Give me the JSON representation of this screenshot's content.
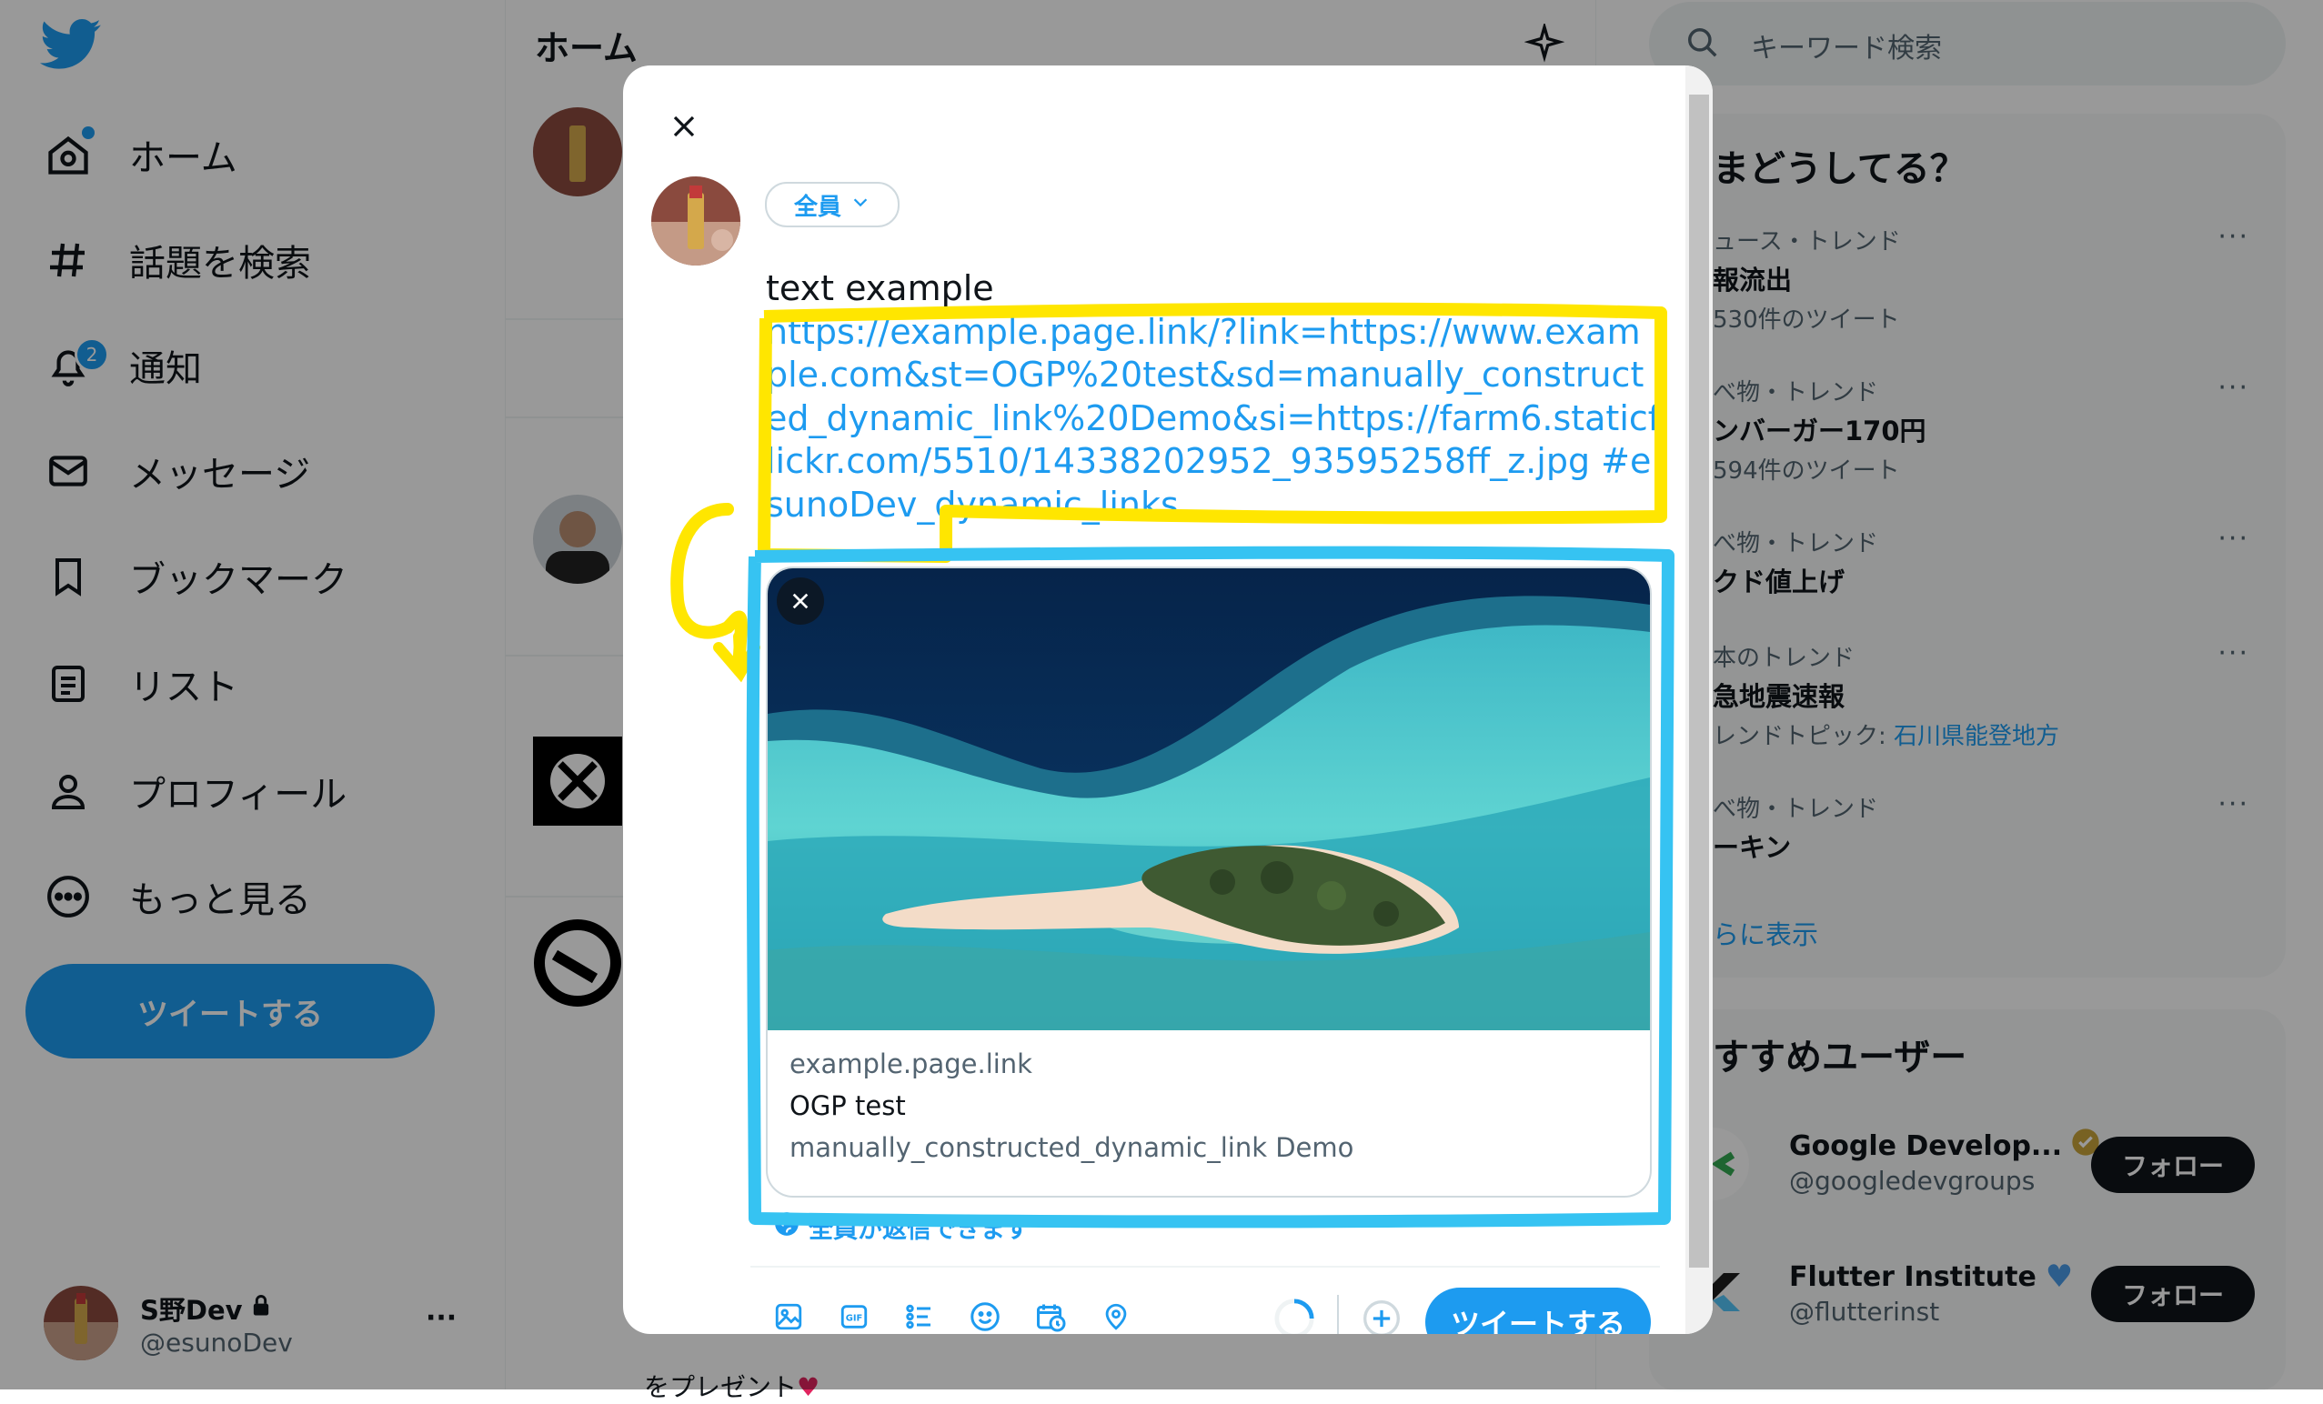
{
  "colors": {
    "accent": "#1d9bf0",
    "annotation_yellow": "#ffe600",
    "annotation_blue": "#36c3f2",
    "annotation_green": "#22c21a"
  },
  "sidebar": {
    "logo_icon": "twitter-bird-icon",
    "items": [
      {
        "label": "ホーム",
        "icon": "home-icon"
      },
      {
        "label": "話題を検索",
        "icon": "hashtag-icon"
      },
      {
        "label": "通知",
        "icon": "bell-icon",
        "badge": "2"
      },
      {
        "label": "メッセージ",
        "icon": "envelope-icon"
      },
      {
        "label": "ブックマーク",
        "icon": "bookmark-icon"
      },
      {
        "label": "リスト",
        "icon": "list-icon"
      },
      {
        "label": "プロフィール",
        "icon": "person-icon"
      },
      {
        "label": "もっと見る",
        "icon": "more-circle-icon"
      }
    ],
    "tweet_button": "ツイートする",
    "account": {
      "name": "S野Dev",
      "handle": "@esunoDev",
      "more": "···"
    }
  },
  "timeline": {
    "title": "ホーム",
    "bottom_text": "をプレゼント"
  },
  "search": {
    "placeholder": "キーワード検索"
  },
  "trends": {
    "heading": "まどうしてる？",
    "items": [
      {
        "category": "ュース・トレンド",
        "name": "報流出",
        "sub": "530件のツイート"
      },
      {
        "category": "べ物・トレンド",
        "name": "ンバーガー170円",
        "sub": "594件のツイート"
      },
      {
        "category": "べ物・トレンド",
        "name": "クド値上げ",
        "sub": ""
      },
      {
        "category": "本のトレンド",
        "name": "急地震速報",
        "sub": "レンドトピック: ",
        "sub_link": "石川県能登地方"
      },
      {
        "category": "べ物・トレンド",
        "name": "ーキン",
        "sub": ""
      }
    ],
    "more_link": "らに表示"
  },
  "who_to_follow": {
    "heading": "すすめユーザー",
    "users": [
      {
        "name": "Google Develop...",
        "handle": "@googledevgroups",
        "button": "フォロー"
      },
      {
        "name": "Flutter Institute",
        "handle": "@flutterinst",
        "button": "フォロー"
      }
    ]
  },
  "modal": {
    "audience": "全員",
    "text_plain": "text example",
    "text_url": " https://example.page.link/?link=https://www.example.com&st=OGP%20test&sd=manually_constructed_dynamic_link%20Demo&si=https://farm6.staticflickr.com/5510/14338202952_93595258ff_z.jpg",
    "text_hashtag": "#esunoDev_dynamic_links",
    "card": {
      "domain": "example.page.link",
      "title": "OGP test",
      "description": "manually_constructed_dynamic_link Demo"
    },
    "reply_setting": "全員が返信できます",
    "tweet_button": "ツイートする",
    "tools": [
      "image-icon",
      "gif-icon",
      "poll-icon",
      "emoji-icon",
      "schedule-icon",
      "location-icon"
    ]
  }
}
